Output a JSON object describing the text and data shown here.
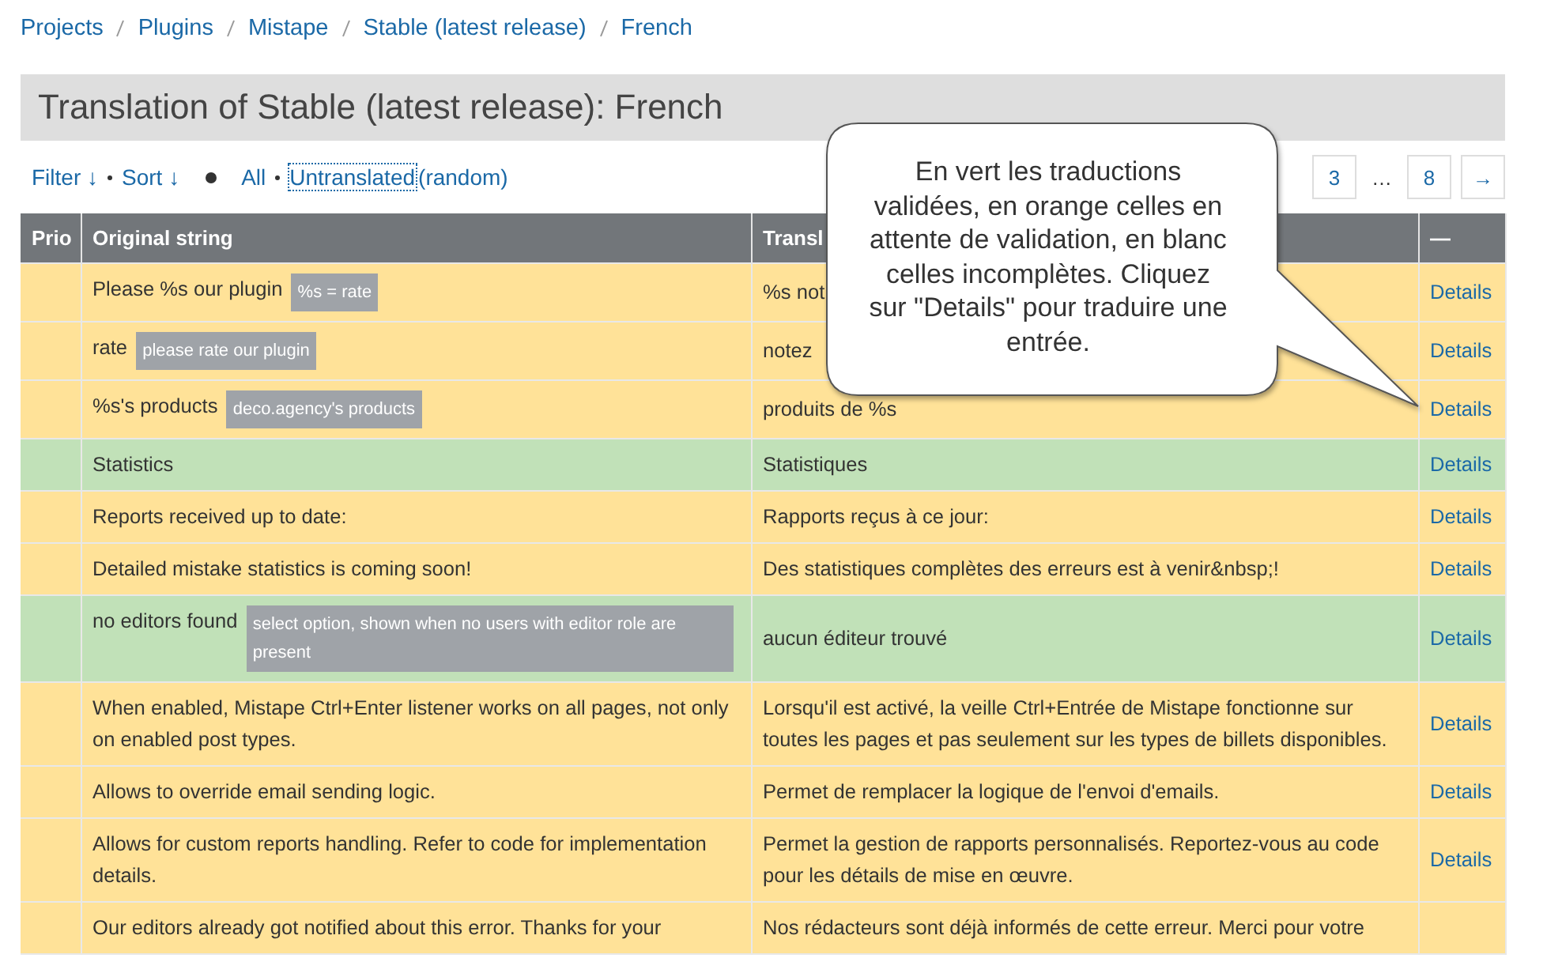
{
  "breadcrumb": [
    "Projects",
    "Plugins",
    "Mistape",
    "Stable (latest release)",
    "French"
  ],
  "title": "Translation of Stable (latest release): French",
  "filter_bar": {
    "filter": "Filter ↓",
    "sort": "Sort ↓",
    "all": "All",
    "untranslated": "Untranslated",
    "random": "(random)"
  },
  "pagination": {
    "pages": [
      {
        "label": "3",
        "kind": "page"
      },
      {
        "label": "…",
        "kind": "gap"
      },
      {
        "label": "8",
        "kind": "page"
      },
      {
        "label": "→",
        "kind": "page"
      }
    ]
  },
  "table": {
    "columns": [
      "Prio",
      "Original string",
      "Transl",
      "—"
    ],
    "rows": [
      {
        "original": "Please %s our plugin",
        "context": "%s = rate",
        "translation": "%s not",
        "kind": "waiting",
        "action": "Details"
      },
      {
        "original": "rate",
        "context": "please rate our plugin",
        "translation": "notez",
        "kind": "waiting",
        "action": "Details"
      },
      {
        "original": "%s's products",
        "context": "deco.agency's products",
        "translation": "produits de %s",
        "kind": "waiting",
        "action": "Details"
      },
      {
        "original": "Statistics",
        "translation": "Statistiques",
        "kind": "current",
        "action": "Details"
      },
      {
        "original": "Reports received up to date:",
        "translation": "Rapports reçus à ce jour:",
        "kind": "waiting",
        "action": "Details"
      },
      {
        "original": "Detailed mistake statistics is coming soon!",
        "translation": "Des statistiques complètes des erreurs est à venir&nbsp;!",
        "kind": "waiting",
        "action": "Details"
      },
      {
        "original": "no editors found",
        "context": "select option, shown when no users with editor role are present",
        "translation": "aucun éditeur trouvé",
        "kind": "current",
        "action": "Details"
      },
      {
        "original": "When enabled, Mistape Ctrl+Enter listener works on all pages, not only on enabled post types.",
        "translation": "Lorsqu'il est activé, la veille Ctrl+Entrée de Mistape fonctionne sur toutes les pages et pas seulement sur les types de billets disponibles.",
        "kind": "waiting",
        "action": "Details"
      },
      {
        "original": "Allows to override email sending logic.",
        "translation": "Permet de remplacer la logique de l'envoi d'emails.",
        "kind": "waiting",
        "action": "Details"
      },
      {
        "original": "Allows for custom reports handling. Refer to code for implementation details.",
        "translation": "Permet la gestion de rapports personnalisés. Reportez-vous au code pour les détails de mise en œuvre.",
        "kind": "waiting",
        "action": "Details"
      },
      {
        "original": "Our editors already got notified about this error. Thanks for your",
        "translation": "Nos rédacteurs sont déjà informés de cette erreur. Merci pour votre",
        "kind": "waiting"
      }
    ]
  },
  "callout": {
    "text": "En vert les traductions validées, en orange celles en attente de validation, en blanc celles incomplètes. Cliquez sur \"Details\" pour traduire une entrée."
  }
}
